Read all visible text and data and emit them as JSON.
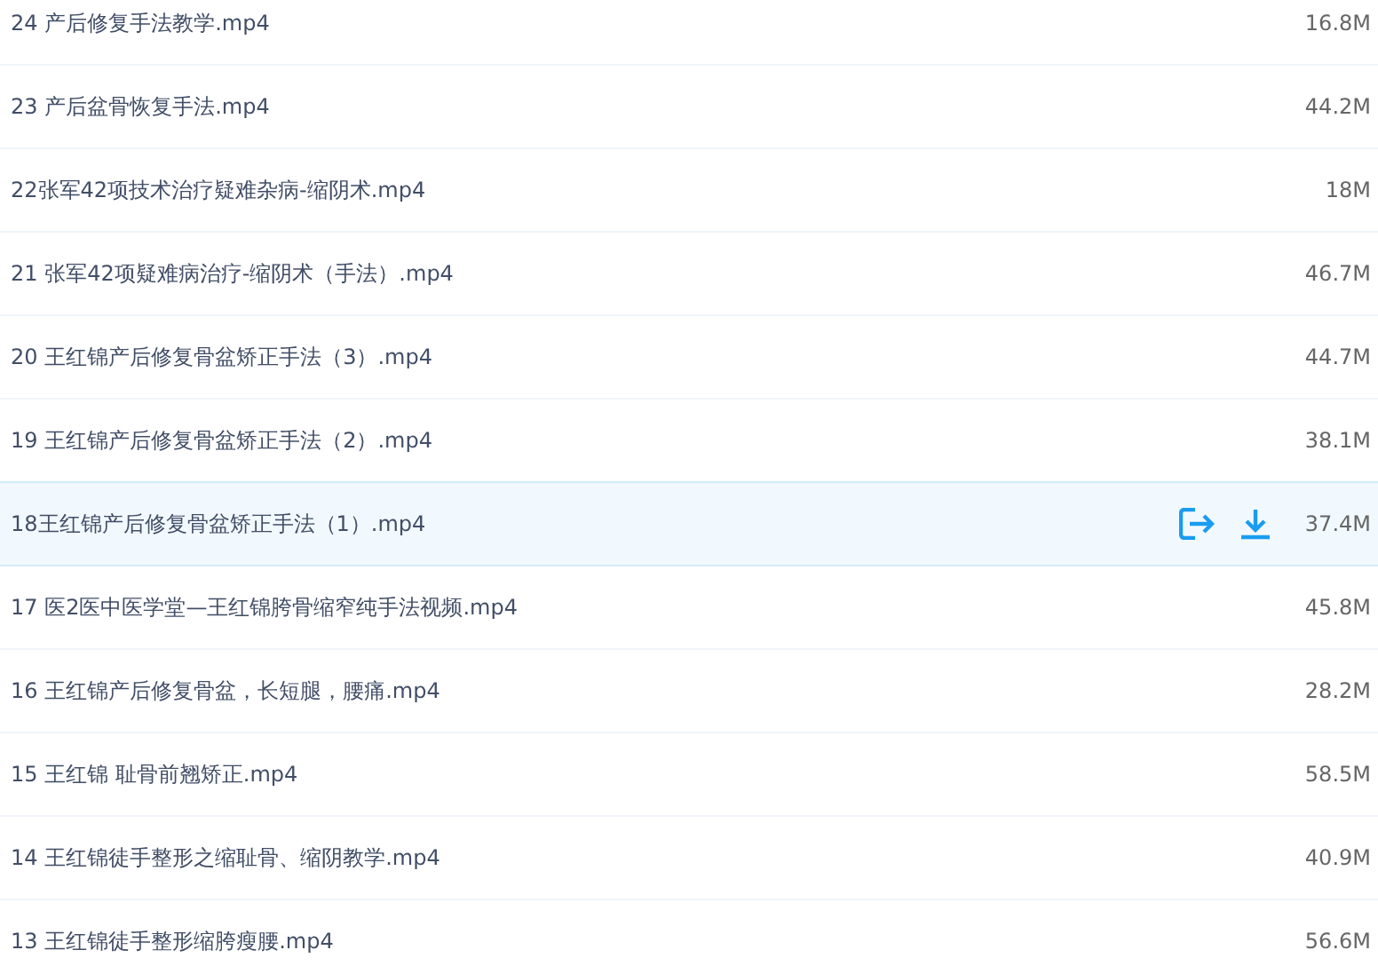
{
  "files": [
    {
      "name": "24 产后修复手法教学.mp4",
      "size": "16.8M",
      "selected": false
    },
    {
      "name": "23 产后盆骨恢复手法.mp4",
      "size": "44.2M",
      "selected": false
    },
    {
      "name": "22张军42项技术治疗疑难杂病-缩阴术.mp4",
      "size": "18M",
      "selected": false
    },
    {
      "name": "21 张军42项疑难病治疗-缩阴术（手法）.mp4",
      "size": "46.7M",
      "selected": false
    },
    {
      "name": "20 王红锦产后修复骨盆矫正手法（3）.mp4",
      "size": "44.7M",
      "selected": false
    },
    {
      "name": "19 王红锦产后修复骨盆矫正手法（2）.mp4",
      "size": "38.1M",
      "selected": false
    },
    {
      "name": "18王红锦产后修复骨盆矫正手法（1）.mp4",
      "size": "37.4M",
      "selected": true
    },
    {
      "name": "17 医2医中医学堂—王红锦胯骨缩窄纯手法视频.mp4",
      "size": "45.8M",
      "selected": false
    },
    {
      "name": "16 王红锦产后修复骨盆，长短腿，腰痛.mp4",
      "size": "28.2M",
      "selected": false
    },
    {
      "name": "15 王红锦 耻骨前翘矫正.mp4",
      "size": "58.5M",
      "selected": false
    },
    {
      "name": "14 王红锦徒手整形之缩耻骨、缩阴教学.mp4",
      "size": "40.9M",
      "selected": false
    },
    {
      "name": "13 王红锦徒手整形缩胯瘦腰.mp4",
      "size": "56.6M",
      "selected": false
    }
  ]
}
